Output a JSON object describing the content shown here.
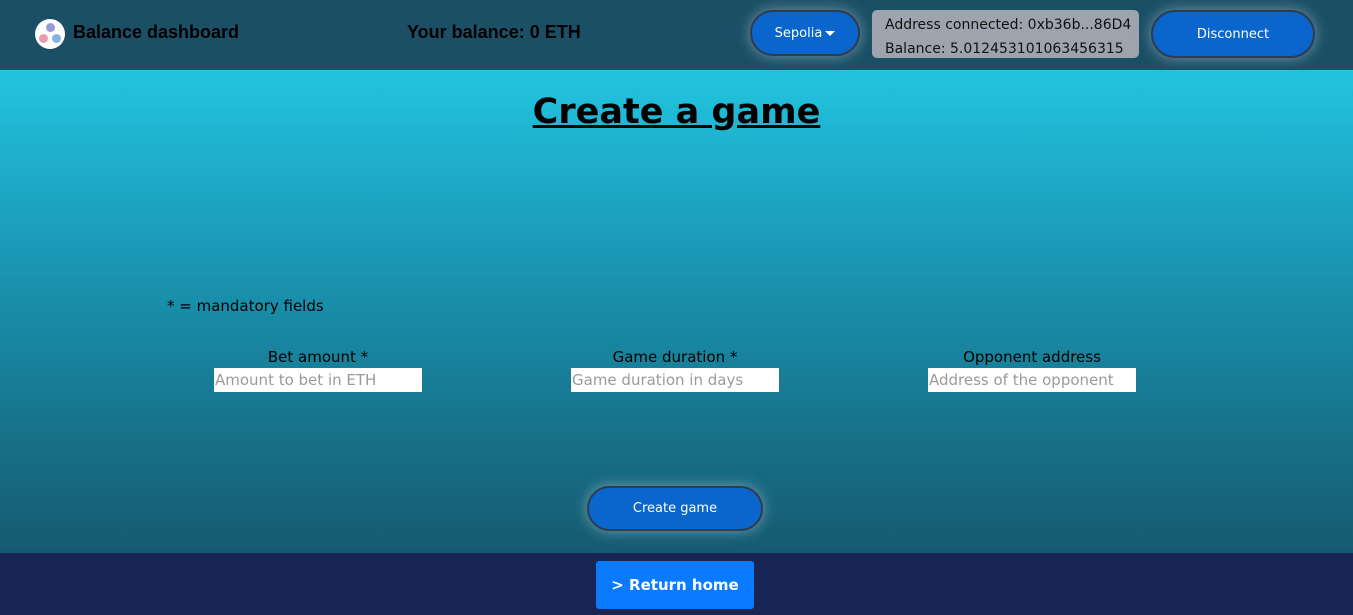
{
  "header": {
    "brand": "Balance dashboard",
    "balance_text": "Your balance: 0 ETH",
    "network_label": "Sepolia",
    "address_line": "Address connected: 0xb36b...86D4",
    "balance_line": "Balance: 5.012453101063456315",
    "disconnect_label": "Disconnect"
  },
  "main": {
    "title": "Create a game",
    "mandatory_note": "* = mandatory fields",
    "fields": [
      {
        "label": "Bet amount *",
        "placeholder": "Amount to bet in ETH",
        "value": ""
      },
      {
        "label": "Game duration *",
        "placeholder": "Game duration in days",
        "value": ""
      },
      {
        "label": "Opponent address",
        "placeholder": "Address of the opponent",
        "value": ""
      }
    ],
    "create_label": "Create game"
  },
  "footer": {
    "return_label": "> Return home"
  },
  "colors": {
    "header_bg": "#1a4f66",
    "button_blue": "#0a66cc",
    "footer_bg": "#172454",
    "return_blue": "#0a7bff"
  },
  "icons": {
    "logo": "three-dot-logo-icon",
    "network_dropdown": "caret-down-icon"
  }
}
